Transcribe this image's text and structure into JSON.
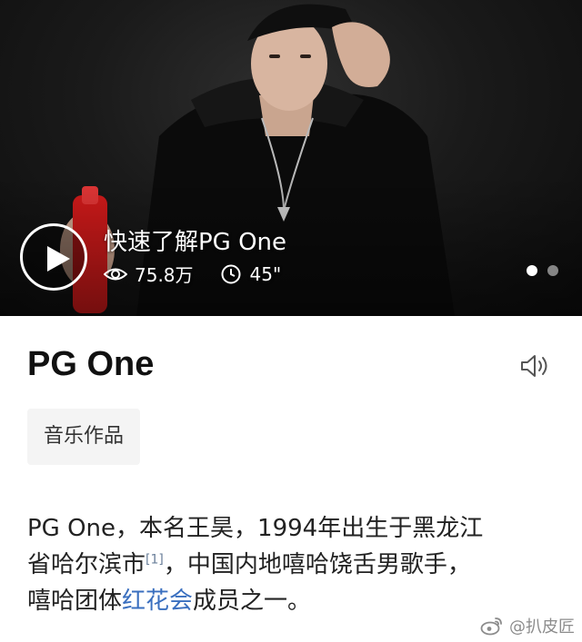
{
  "video": {
    "title": "快速了解PG One",
    "views": "75.8万",
    "duration": "45\"",
    "play_icon": "play-icon",
    "views_icon": "eye-icon",
    "duration_icon": "clock-icon",
    "slides_total": 2,
    "slide_active": 1
  },
  "entry": {
    "title": "PG One",
    "speaker_icon": "speaker-icon",
    "tag": "音乐作品"
  },
  "summary": {
    "line1": "PG One，本名王昊，1994年出生于黑龙江",
    "line2_before": "省哈尔滨市",
    "citation": "[1]",
    "line2_after": "，中国内地嘻哈饶舌男歌手，",
    "line3_before": "嘻哈团体",
    "link": "红花会",
    "line3_after": "成员之一。"
  },
  "watermark": {
    "icon": "weibo-icon",
    "text": "@扒皮匠"
  },
  "colors": {
    "link": "#3a6fbf",
    "chip_bg": "#f4f4f4",
    "hero_bg": "#151515"
  }
}
